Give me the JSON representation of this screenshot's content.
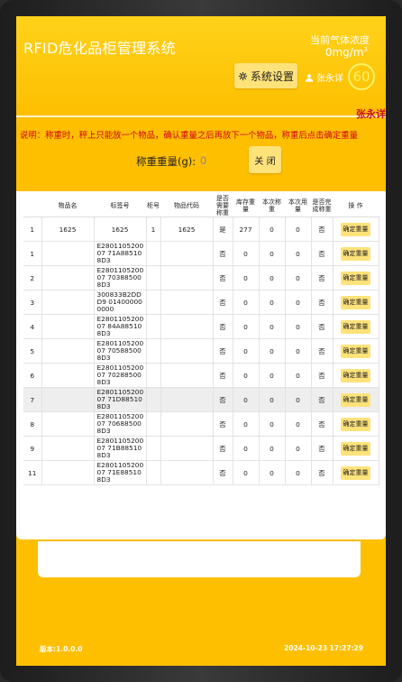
{
  "header": {
    "app_title": "RFID危化品柜管理系统",
    "gas_label": "当前气体浓度",
    "gas_value": "0mg/m",
    "gas_unit_sup": "3",
    "settings_label": "系统设置",
    "user_name": "张永详",
    "countdown": "60",
    "current_user_red": "张永详"
  },
  "weighing": {
    "note": "说明：称重时，秤上只能放一个物品，确认重量之后再放下一个物品，称重后点击确定重量",
    "weight_label": "称重重量(g):",
    "weight_value": "0",
    "close_label": "关 闭"
  },
  "table": {
    "headers": [
      "",
      "物品名",
      "标签号",
      "柜号",
      "物品代码",
      "是否需要称重",
      "库存重量",
      "本次称重",
      "本次用量",
      "是否完成称重",
      "操 作"
    ],
    "action_label": "确定重量",
    "rows": [
      {
        "no": "1",
        "name": "1625",
        "tag": "1625",
        "cabinet": "1",
        "code": "1625",
        "need": "是",
        "stock": "277",
        "weigh": "0",
        "usage": "0",
        "done": "否"
      },
      {
        "no": "1",
        "name": "",
        "tag": "E280110520007 71A885108D3",
        "cabinet": "",
        "code": "",
        "need": "否",
        "stock": "0",
        "weigh": "0",
        "usage": "0",
        "done": "否"
      },
      {
        "no": "2",
        "name": "",
        "tag": "E280110520007 703885008D3",
        "cabinet": "",
        "code": "",
        "need": "否",
        "stock": "0",
        "weigh": "0",
        "usage": "0",
        "done": "否"
      },
      {
        "no": "3",
        "name": "",
        "tag": "300833B2DDD9 014000000000",
        "cabinet": "",
        "code": "",
        "need": "否",
        "stock": "0",
        "weigh": "0",
        "usage": "0",
        "done": "否"
      },
      {
        "no": "4",
        "name": "",
        "tag": "E280110520007 84A885108D3",
        "cabinet": "",
        "code": "",
        "need": "否",
        "stock": "0",
        "weigh": "0",
        "usage": "0",
        "done": "否"
      },
      {
        "no": "5",
        "name": "",
        "tag": "E280110520007 705885008D3",
        "cabinet": "",
        "code": "",
        "need": "否",
        "stock": "0",
        "weigh": "0",
        "usage": "0",
        "done": "否"
      },
      {
        "no": "6",
        "name": "",
        "tag": "E280110520007 702885008D3",
        "cabinet": "",
        "code": "",
        "need": "否",
        "stock": "0",
        "weigh": "0",
        "usage": "0",
        "done": "否"
      },
      {
        "no": "7",
        "name": "",
        "tag": "E280110520007 71D885108D3",
        "cabinet": "",
        "code": "",
        "need": "否",
        "stock": "0",
        "weigh": "0",
        "usage": "0",
        "done": "否"
      },
      {
        "no": "8",
        "name": "",
        "tag": "E280110520007 706885008D3",
        "cabinet": "",
        "code": "",
        "need": "否",
        "stock": "0",
        "weigh": "0",
        "usage": "0",
        "done": "否"
      },
      {
        "no": "9",
        "name": "",
        "tag": "E280110520007 71B885108D3",
        "cabinet": "",
        "code": "",
        "need": "否",
        "stock": "0",
        "weigh": "0",
        "usage": "0",
        "done": "否"
      },
      {
        "no": "11",
        "name": "",
        "tag": "E280110520007 71E885108D3",
        "cabinet": "",
        "code": "",
        "need": "否",
        "stock": "0",
        "weigh": "0",
        "usage": "0",
        "done": "否"
      }
    ]
  },
  "footer": {
    "version": "版本:1.0.0.0",
    "datetime": "2024-10-23 17:27:29"
  },
  "colors": {
    "primary": "#fdbf00",
    "button": "#ffe27a",
    "note_red": "#d0021b",
    "timer": "#fff26a"
  }
}
